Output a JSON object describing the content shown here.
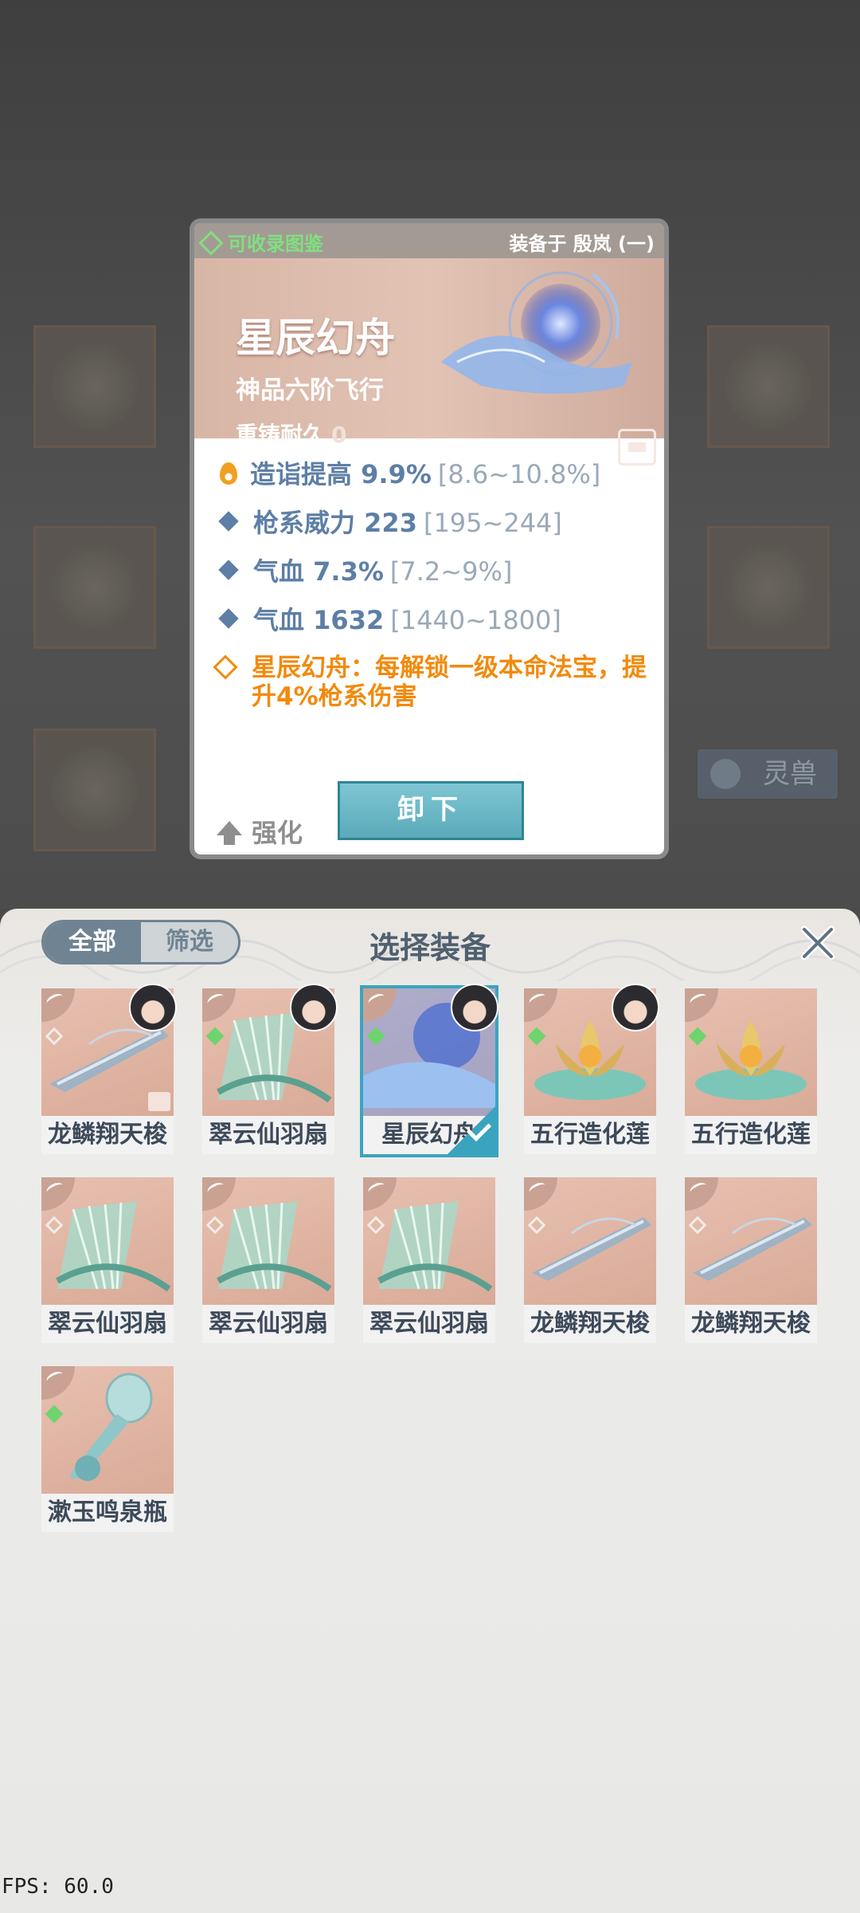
{
  "background": {
    "tag_label": "灵兽"
  },
  "card": {
    "collect_label": "可收录图鉴",
    "equipped_label": "装备于 殷岚 (一)",
    "name": "星辰幻舟",
    "grade": "神品六阶飞行",
    "durability_label": "重铸耐久",
    "durability_value": "0",
    "attributes": [
      {
        "icon": "flame-icon",
        "name": "造诣提高",
        "value": "9.9%",
        "range": "[8.6~10.8%]"
      },
      {
        "icon": "diamond-icon",
        "name": "枪系威力",
        "value": "223",
        "range": "[195~244]"
      },
      {
        "icon": "diamond-icon",
        "name": "气血",
        "value": "7.3%",
        "range": "[7.2~9%]"
      },
      {
        "icon": "diamond-icon",
        "name": "气血",
        "value": "1632",
        "range": "[1440~1800]"
      }
    ],
    "skill_text": "星辰幻舟：每解锁一级本命法宝，提升4%枪系伤害",
    "enhance_label": "强化",
    "unequip_label": "卸下"
  },
  "panel": {
    "tab_all": "全部",
    "tab_filter": "筛选",
    "title": "选择装备",
    "items": [
      {
        "label": "龙鳞翔天梭",
        "kind": "shuttle",
        "has_avatar": true,
        "mark": "plain",
        "locked": true,
        "selected": false
      },
      {
        "label": "翠云仙羽扇",
        "kind": "fan",
        "has_avatar": true,
        "mark": "green",
        "locked": false,
        "selected": false
      },
      {
        "label": "星辰幻舟",
        "kind": "boat",
        "has_avatar": true,
        "mark": "green",
        "locked": false,
        "selected": true
      },
      {
        "label": "五行造化莲",
        "kind": "lotus",
        "has_avatar": true,
        "mark": "green",
        "locked": false,
        "selected": false
      },
      {
        "label": "五行造化莲",
        "kind": "lotus",
        "has_avatar": false,
        "mark": "green",
        "locked": false,
        "selected": false
      },
      {
        "label": "翠云仙羽扇",
        "kind": "fan",
        "has_avatar": false,
        "mark": "plain",
        "locked": false,
        "selected": false
      },
      {
        "label": "翠云仙羽扇",
        "kind": "fan",
        "has_avatar": false,
        "mark": "plain",
        "locked": false,
        "selected": false
      },
      {
        "label": "翠云仙羽扇",
        "kind": "fan",
        "has_avatar": false,
        "mark": "plain",
        "locked": false,
        "selected": false
      },
      {
        "label": "龙鳞翔天梭",
        "kind": "shuttle",
        "has_avatar": false,
        "mark": "plain",
        "locked": false,
        "selected": false
      },
      {
        "label": "龙鳞翔天梭",
        "kind": "shuttle",
        "has_avatar": false,
        "mark": "plain",
        "locked": false,
        "selected": false
      },
      {
        "label": "漱玉鸣泉瓶",
        "kind": "vase",
        "has_avatar": false,
        "mark": "green",
        "locked": false,
        "selected": false
      }
    ]
  },
  "fps": "FPS: 60.0"
}
